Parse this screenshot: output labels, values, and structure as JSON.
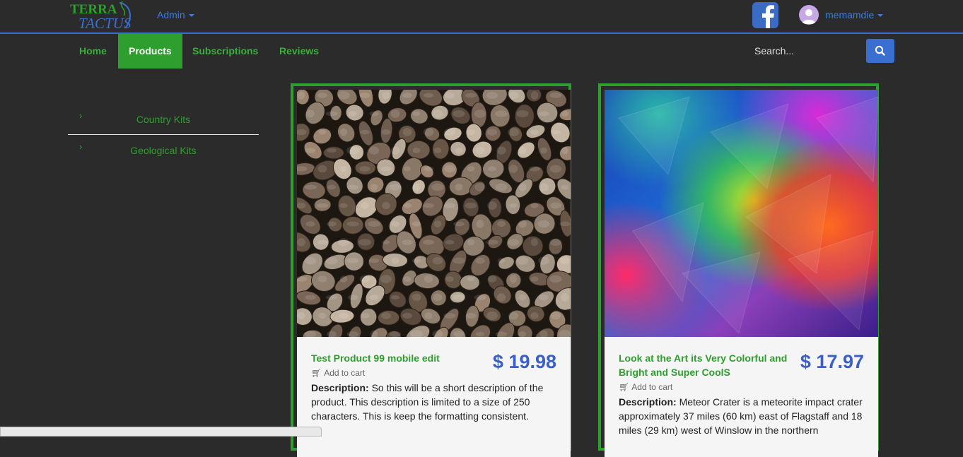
{
  "logo": {
    "line1": "TERRA",
    "line2": "TACTUS"
  },
  "topbar": {
    "admin_label": "Admin",
    "username": "memamdie"
  },
  "nav": [
    {
      "label": "Home",
      "active": false
    },
    {
      "label": "Products",
      "active": true
    },
    {
      "label": "Subscriptions",
      "active": false
    },
    {
      "label": "Reviews",
      "active": false
    }
  ],
  "search": {
    "placeholder": "Search..."
  },
  "sidebar": {
    "items": [
      {
        "label": "Country Kits"
      },
      {
        "label": "Geological Kits"
      }
    ]
  },
  "products": [
    {
      "title": "Test Product 99 mobile edit",
      "price": "$ 19.98",
      "cart_label": "Add to cart",
      "desc_label": "Description:",
      "description": "So this will be a short description of the product. This description is limited to a size of 250 characters. This is keep the formatting consistent.",
      "image": "pebbles"
    },
    {
      "title": "Look at the Art its Very Colorful and Bright and Super CoolS",
      "price": "$ 17.97",
      "cart_label": "Add to cart",
      "desc_label": "Description:",
      "description": "Meteor Crater is a meteorite impact crater approximately 37 miles (60 km) east of Flagstaff and 18 miles (29 km) west of Winslow in the northern",
      "image": "colorful-abstract"
    }
  ],
  "colors": {
    "accent_green": "#2e9e2e",
    "link_blue": "#3d7be0",
    "price_blue": "#3a5fc7",
    "background": "#2b2b2b"
  }
}
